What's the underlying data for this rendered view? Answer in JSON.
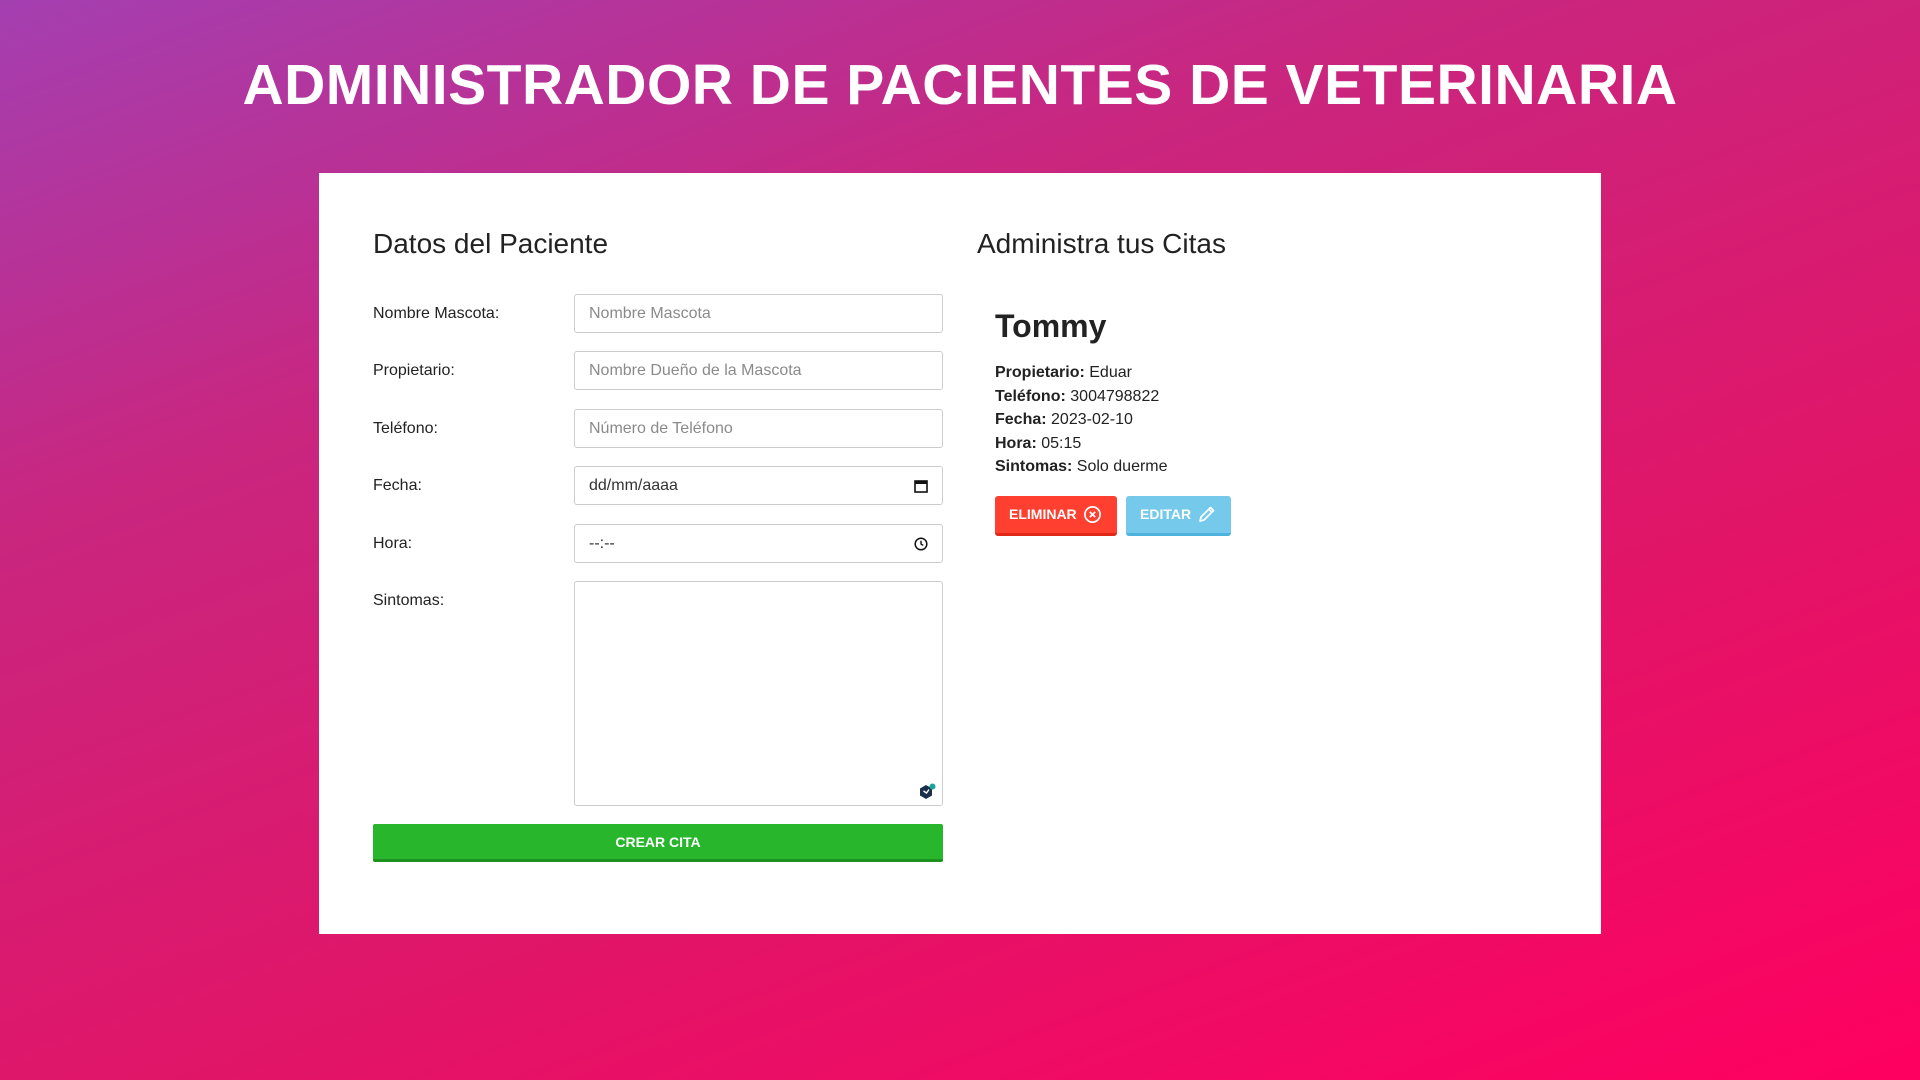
{
  "header": {
    "title": "ADMINISTRADOR DE PACIENTES DE VETERINARIA"
  },
  "form": {
    "title": "Datos del Paciente",
    "fields": [
      {
        "label": "Nombre Mascota:",
        "placeholder": "Nombre Mascota",
        "value": ""
      },
      {
        "label": "Propietario:",
        "placeholder": "Nombre Dueño de la Mascota",
        "value": ""
      },
      {
        "label": "Teléfono:",
        "placeholder": "Número de Teléfono",
        "value": ""
      },
      {
        "label": "Fecha:",
        "placeholder": "dd/mm/aaaa",
        "value": ""
      },
      {
        "label": "Hora:",
        "placeholder": "--:--",
        "value": ""
      },
      {
        "label": "Sintomas:",
        "placeholder": "",
        "value": ""
      }
    ],
    "submit_label": "CREAR CITA"
  },
  "citas": {
    "title": "Administra tus Citas",
    "items": [
      {
        "mascota": "Tommy",
        "propietario_label": "Propietario:",
        "propietario": "Eduar",
        "telefono_label": "Teléfono:",
        "telefono": "3004798822",
        "fecha_label": "Fecha:",
        "fecha": "2023-02-10",
        "hora_label": "Hora:",
        "hora": "05:15",
        "sintomas_label": "Sintomas:",
        "sintomas": "Solo duerme",
        "delete_label": "ELIMINAR",
        "edit_label": "EDITAR"
      }
    ]
  },
  "icons": {
    "calendar": "calendar-icon",
    "clock": "clock-icon",
    "delete": "close-circle-icon",
    "edit": "pencil-icon",
    "grammar": "grammar-assistant-icon"
  },
  "colors": {
    "submit": "#28b62c",
    "delete": "#ff3f2f",
    "edit": "#75caeb",
    "gradient_start": "#a43fb1",
    "gradient_end": "#ff0060"
  }
}
